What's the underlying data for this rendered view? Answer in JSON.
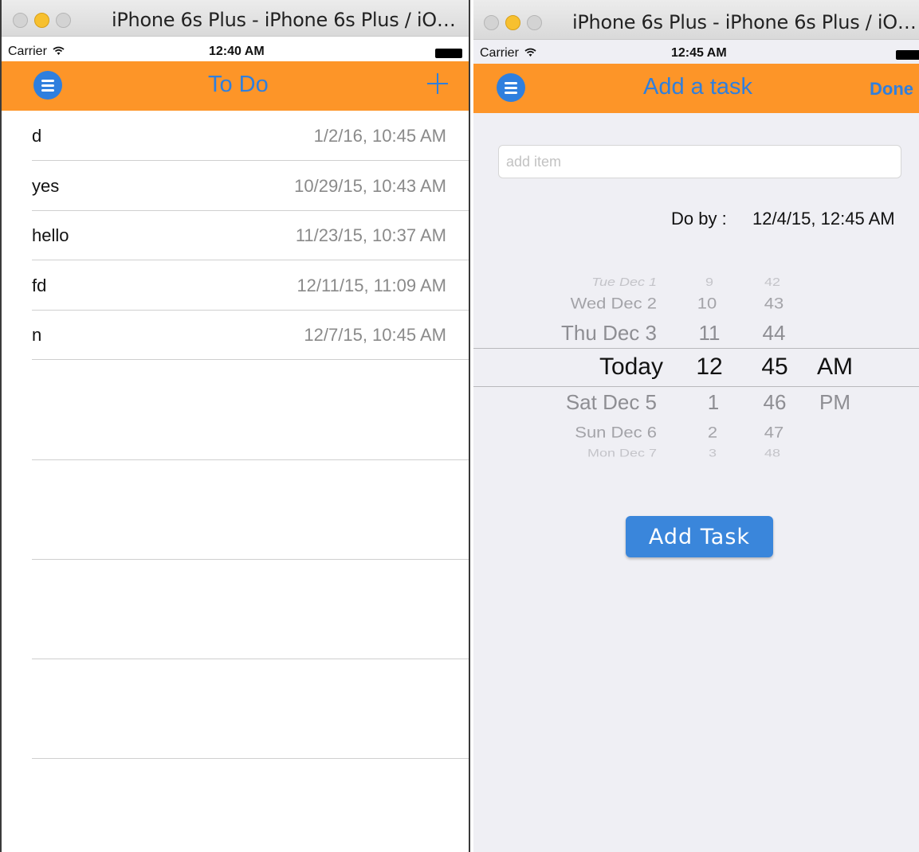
{
  "left": {
    "window": {
      "title": "iPhone 6s Plus - iPhone 6s Plus / iO…"
    },
    "status": {
      "carrier": "Carrier",
      "time": "12:40 AM"
    },
    "nav": {
      "title": "To Do",
      "add_symbol": "+"
    },
    "tasks": [
      {
        "name": "d",
        "date": "1/2/16, 10:45 AM"
      },
      {
        "name": "yes",
        "date": "10/29/15, 10:43 AM"
      },
      {
        "name": "hello",
        "date": "11/23/15, 10:37 AM"
      },
      {
        "name": "fd",
        "date": "12/11/15, 11:09 AM"
      },
      {
        "name": "n",
        "date": "12/7/15, 10:45 AM"
      }
    ]
  },
  "right": {
    "window": {
      "title": "iPhone 6s Plus - iPhone 6s Plus / iO…"
    },
    "status": {
      "carrier": "Carrier",
      "time": "12:45 AM"
    },
    "nav": {
      "title": "Add a task",
      "done_label": "Done"
    },
    "form": {
      "item_placeholder": "add item",
      "item_value": "",
      "do_by_label": "Do by :",
      "do_by_value": "12/4/15, 12:45 AM"
    },
    "picker": {
      "days": [
        "Tue Dec 1",
        "Wed Dec 2",
        "Thu Dec 3",
        "Today",
        "Sat Dec 5",
        "Sun Dec 6",
        "Mon Dec 7"
      ],
      "hours": [
        "9",
        "10",
        "11",
        "12",
        "1",
        "2",
        "3"
      ],
      "minutes": [
        "42",
        "43",
        "44",
        "45",
        "46",
        "47",
        "48"
      ],
      "ampm": [
        "AM",
        "PM"
      ]
    },
    "add_button_label": "Add Task"
  },
  "icons": {
    "menu": "menu-icon",
    "add": "plus-icon",
    "wifi": "wifi-icon",
    "battery": "battery-icon"
  },
  "colors": {
    "nav_orange": "#fd9528",
    "accent_blue": "#2f7fde",
    "button_blue": "#3a86db"
  }
}
